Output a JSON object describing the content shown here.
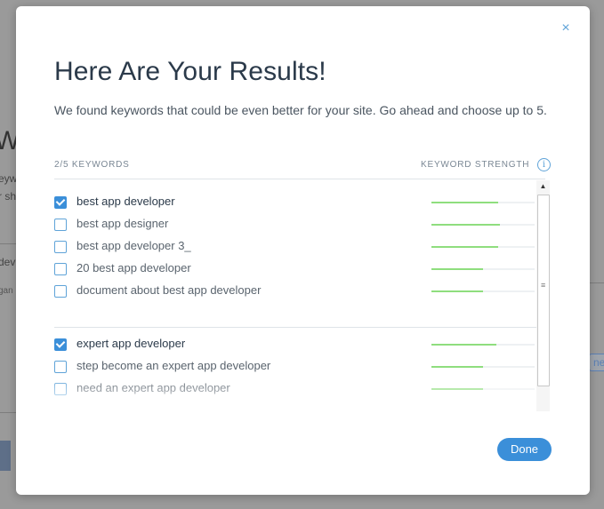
{
  "background": {
    "fragments": [
      "Wo",
      "eyw",
      "r sh",
      "dev",
      "gan",
      "nete"
    ]
  },
  "modal": {
    "close_glyph": "×",
    "title": "Here Are Your Results!",
    "subtitle": "We found keywords that could be even better for your site. Go ahead and choose up to 5.",
    "count_header": "2/5 KEYWORDS",
    "strength_header": "KEYWORD STRENGTH",
    "info_glyph": "i",
    "done_label": "Done",
    "colors": {
      "accent": "#3b8fd9",
      "bar": "#8fde7e",
      "title": "#2b3a4a"
    }
  },
  "keyword_groups": [
    {
      "items": [
        {
          "label": "best app developer",
          "checked": true,
          "strength": 0.65
        },
        {
          "label": "best app designer",
          "checked": false,
          "strength": 0.66
        },
        {
          "label": "best app developer 3_",
          "checked": false,
          "strength": 0.65
        },
        {
          "label": "20 best app developer",
          "checked": false,
          "strength": 0.5
        },
        {
          "label": "document about best app developer",
          "checked": false,
          "strength": 0.5
        }
      ]
    },
    {
      "items": [
        {
          "label": "expert app developer",
          "checked": true,
          "strength": 0.63
        },
        {
          "label": "step become an expert app developer",
          "checked": false,
          "strength": 0.5
        },
        {
          "label": "need an expert app developer",
          "checked": false,
          "strength": 0.5
        }
      ]
    }
  ]
}
